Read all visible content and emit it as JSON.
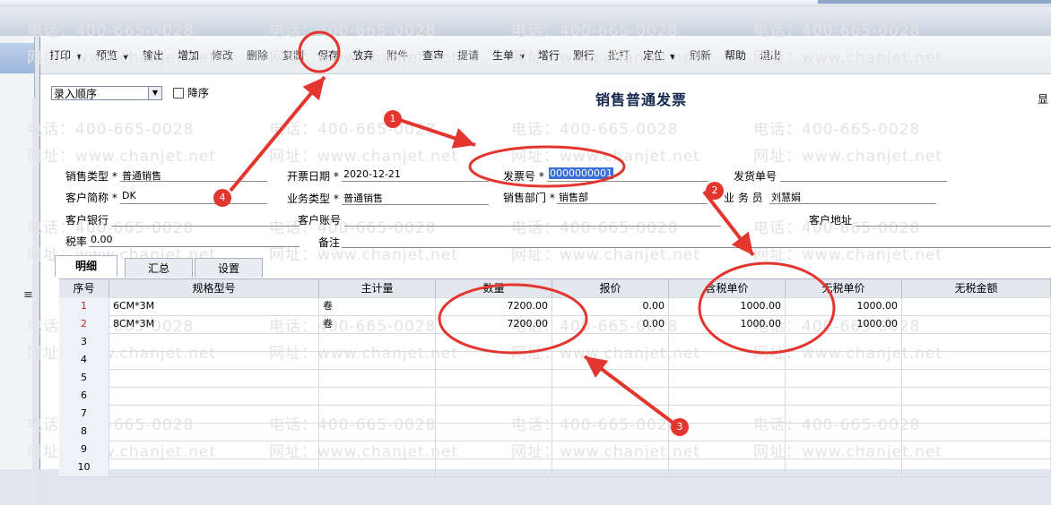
{
  "toolbar": {
    "print": "打印",
    "preview": "预览",
    "export": "输出",
    "add": "增加",
    "edit": "修改",
    "delete": "删除",
    "copy": "复制",
    "save": "保存",
    "discard": "放弃",
    "attach": "附件",
    "audit": "查审",
    "prompt": "提请",
    "gen": "生单",
    "add_row": "增行",
    "del_row": "删行",
    "batch_print": "批打",
    "locate": "定位",
    "refresh": "刷新",
    "help": "帮助",
    "exit": "退出"
  },
  "sort": {
    "value": "录入顺序",
    "desc_label": "降序"
  },
  "doc_title": "销售普通发票",
  "display_label": "显",
  "watermark": {
    "phone": "电话：400-665-0028",
    "site": "网址：www.chanjet.net"
  },
  "header": {
    "sale_type": {
      "label": "销售类型",
      "value": "普通销售"
    },
    "invoice_date": {
      "label": "开票日期",
      "value": "2020-12-21"
    },
    "invoice_no": {
      "label": "发票号",
      "value": "0000000001"
    },
    "ship_no": {
      "label": "发货单号",
      "value": ""
    },
    "customer": {
      "label": "客户简称",
      "value": "DK"
    },
    "biz_type": {
      "label": "业务类型",
      "value": "普通销售"
    },
    "dept": {
      "label": "销售部门",
      "value": "销售部"
    },
    "salesman": {
      "label": "业 务 员",
      "value": "刘慧娟"
    },
    "bank": {
      "label": "客户银行"
    },
    "account": {
      "label": "客户账号"
    },
    "address": {
      "label": "客户地址"
    },
    "tax_rate": {
      "label": "税率",
      "value": "0.00"
    },
    "remark": {
      "label": "备注"
    },
    "required_mark": "*"
  },
  "tabs": [
    "明细",
    "汇总",
    "设置"
  ],
  "table": {
    "columns": [
      "序号",
      "规格型号",
      "主计量",
      "数量",
      "报价",
      "含税单价",
      "无税单价",
      "无税金额"
    ],
    "rows": [
      [
        "1",
        "6CM*3M",
        "卷",
        "7200.00",
        "0.00",
        "1000.00",
        "1000.00",
        ""
      ],
      [
        "2",
        "8CM*3M",
        "卷",
        "7200.00",
        "0.00",
        "1000.00",
        "1000.00",
        ""
      ],
      [
        "3",
        "",
        "",
        "",
        "",
        "",
        "",
        ""
      ],
      [
        "4",
        "",
        "",
        "",
        "",
        "",
        "",
        ""
      ],
      [
        "5",
        "",
        "",
        "",
        "",
        "",
        "",
        ""
      ],
      [
        "6",
        "",
        "",
        "",
        "",
        "",
        "",
        ""
      ],
      [
        "7",
        "",
        "",
        "",
        "",
        "",
        "",
        ""
      ],
      [
        "8",
        "",
        "",
        "",
        "",
        "",
        "",
        ""
      ],
      [
        "9",
        "",
        "",
        "",
        "",
        "",
        "",
        ""
      ],
      [
        "10",
        "",
        "",
        "",
        "",
        "",
        "",
        ""
      ]
    ]
  },
  "annotations": {
    "badge1": "1",
    "badge2": "2",
    "badge3": "3",
    "badge4": "4"
  },
  "colors": {
    "annotation": "#e2362e",
    "selection": "#3b6fd8"
  }
}
